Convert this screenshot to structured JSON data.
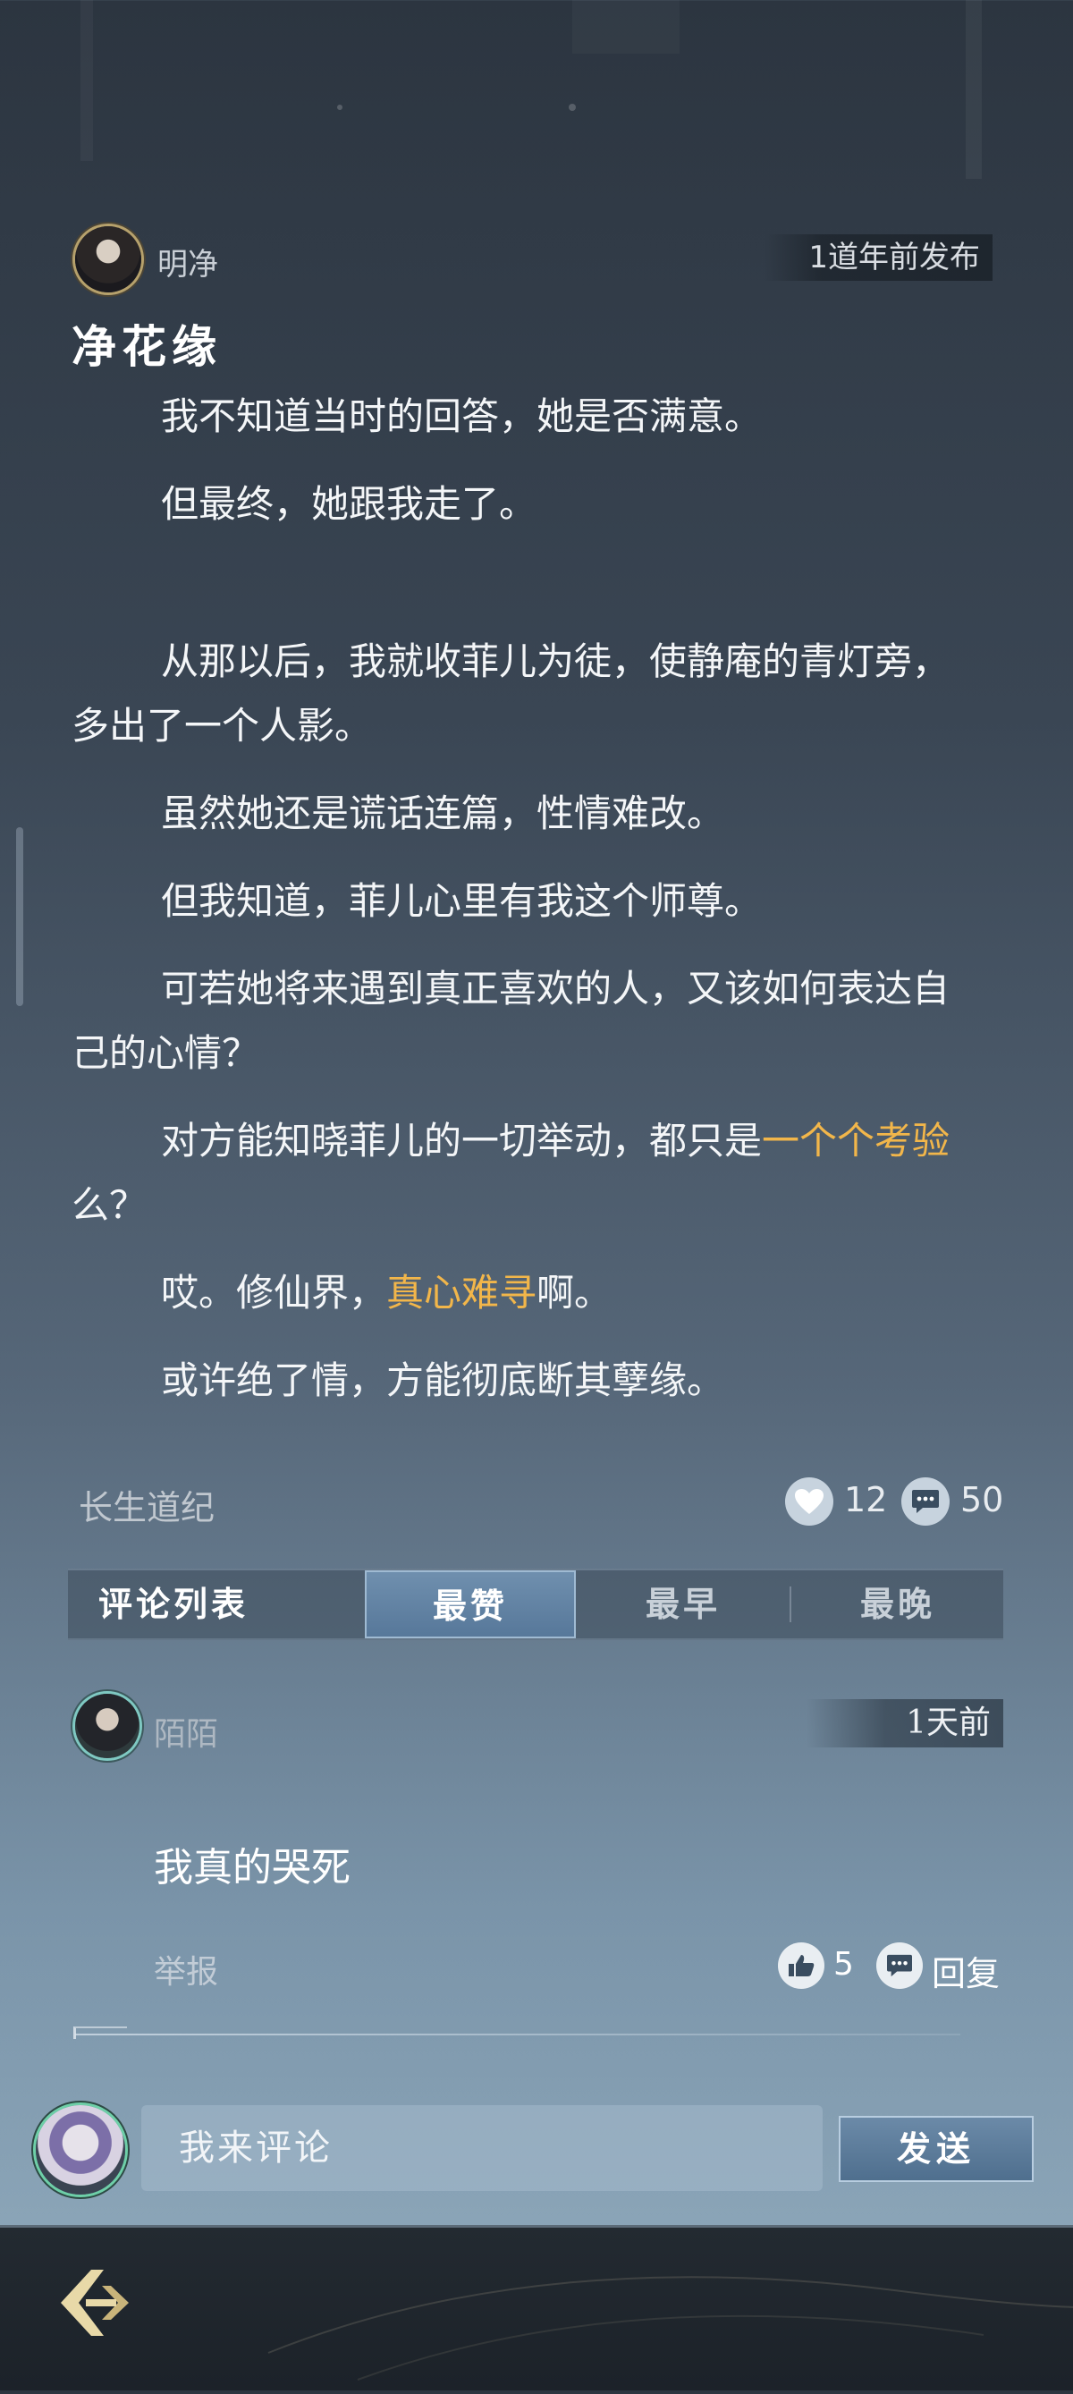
{
  "post": {
    "author": "明净",
    "time": "1道年前发布",
    "title": "净花缘",
    "paragraphs": [
      {
        "segments": [
          {
            "text": "我不知道当时的回答，她是否满意。",
            "hl": false
          }
        ]
      },
      {
        "segments": [
          {
            "text": "但最终，她跟我走了。",
            "hl": false
          }
        ]
      },
      {
        "segments": [
          {
            "text": "从那以后，我就收菲儿为徒，使静庵的青灯旁，多出了一个人影。",
            "hl": false
          }
        ],
        "gap": true
      },
      {
        "segments": [
          {
            "text": "虽然她还是谎话连篇，性情难改。",
            "hl": false
          }
        ]
      },
      {
        "segments": [
          {
            "text": "但我知道，菲儿心里有我这个师尊。",
            "hl": false
          }
        ]
      },
      {
        "segments": [
          {
            "text": "可若她将来遇到真正喜欢的人，又该如何表达自己的心情？",
            "hl": false
          }
        ]
      },
      {
        "segments": [
          {
            "text": "对方能知晓菲儿的一切举动，都只是",
            "hl": false
          },
          {
            "text": "一个个考验",
            "hl": true
          },
          {
            "text": "么？",
            "hl": false
          }
        ]
      },
      {
        "segments": [
          {
            "text": "哎。修仙界，",
            "hl": false
          },
          {
            "text": "真心难寻",
            "hl": true
          },
          {
            "text": "啊。",
            "hl": false
          }
        ]
      },
      {
        "segments": [
          {
            "text": "或许绝了情，方能彻底断其孽缘。",
            "hl": false
          }
        ]
      }
    ],
    "book_name": "长生道纪",
    "likes": "12",
    "comments": "50"
  },
  "tabs": {
    "list_label": "评论列表",
    "items": [
      {
        "label": "最赞",
        "active": true
      },
      {
        "label": "最早",
        "active": false
      },
      {
        "label": "最晚",
        "active": false
      }
    ]
  },
  "comment": {
    "name": "陌陌",
    "time": "1天前",
    "text": "我真的哭死",
    "report_label": "举报",
    "likes": "5",
    "reply_label": "回复"
  },
  "composer": {
    "placeholder": "我来评论",
    "send_label": "发送"
  },
  "colors": {
    "highlight": "#f2b64a",
    "active_tab": "#5f80a2"
  },
  "icons": [
    "heart-icon",
    "comment-bubble-icon",
    "thumb-like-icon",
    "back-arrow-icon"
  ]
}
